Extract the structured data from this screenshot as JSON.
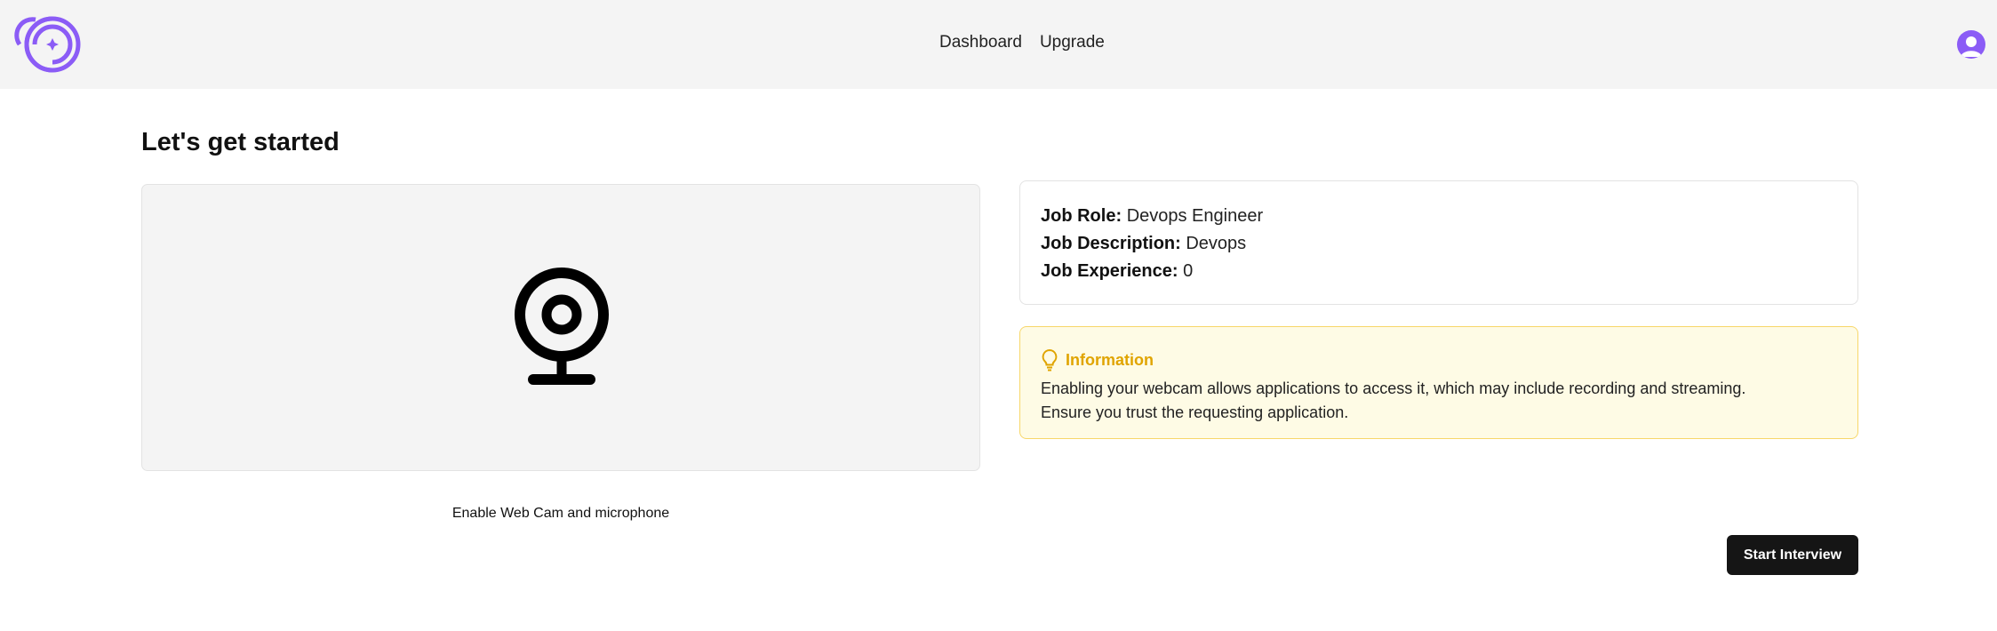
{
  "header": {
    "nav": [
      {
        "label": "Dashboard"
      },
      {
        "label": "Upgrade"
      }
    ],
    "logo_icon": "logo-icon",
    "avatar_icon": "user-avatar-icon",
    "accent_color": "#8b5cf6"
  },
  "page": {
    "title": "Let's get started"
  },
  "webcam": {
    "icon": "webcam-icon",
    "enable_label": "Enable Web Cam and microphone"
  },
  "job_info": {
    "role_label": "Job Role:",
    "role_value": "Devops Engineer",
    "description_label": "Job Description:",
    "description_value": "Devops",
    "experience_label": "Job Experience:",
    "experience_value": "0"
  },
  "alert": {
    "icon": "lightbulb-icon",
    "title": "Information",
    "body_line1": "Enabling your webcam allows applications to access it, which may include recording and streaming.",
    "body_line2": "Ensure you trust the requesting application.",
    "color": "#e0a400"
  },
  "actions": {
    "start_label": "Start Interview"
  }
}
